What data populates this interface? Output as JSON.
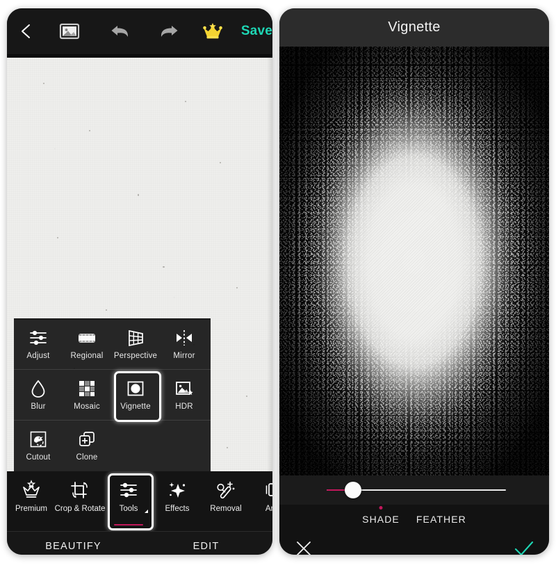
{
  "app": {
    "left_screen": {
      "topbar": {
        "back_icon": "chevron-left-icon",
        "photo_icon": "photo-gallery-icon",
        "undo_icon": "undo-arrow-icon",
        "redo_icon": "redo-arrow-icon",
        "premium_icon": "crown-star-icon",
        "save_label": "Save",
        "save_color": "#1ed6b4"
      },
      "tools_panel": {
        "selected": "Vignette",
        "items": [
          {
            "label": "Adjust",
            "icon": "sliders-icon"
          },
          {
            "label": "Regional",
            "icon": "regional-band-icon"
          },
          {
            "label": "Perspective",
            "icon": "perspective-grid-icon"
          },
          {
            "label": "Mirror",
            "icon": "mirror-icon"
          },
          {
            "label": "Blur",
            "icon": "water-drop-icon"
          },
          {
            "label": "Mosaic",
            "icon": "mosaic-grid-icon"
          },
          {
            "label": "Vignette",
            "icon": "vignette-frame-icon"
          },
          {
            "label": "HDR",
            "icon": "hdr-photo-icon"
          },
          {
            "label": "Cutout",
            "icon": "cutout-duck-icon"
          },
          {
            "label": "Clone",
            "icon": "clone-plus-icon"
          }
        ]
      },
      "bottom_strip": {
        "selected": "Tools",
        "accent_color": "#c2185b",
        "items": [
          {
            "label": "Premium",
            "icon": "crown-star-outline-icon"
          },
          {
            "label": "Crop & Rotate",
            "icon": "crop-rotate-icon"
          },
          {
            "label": "Tools",
            "icon": "sliders-icon"
          },
          {
            "label": "Effects",
            "icon": "magic-sparkle-icon"
          },
          {
            "label": "Removal",
            "icon": "magic-wand-icon"
          },
          {
            "label": "Anim",
            "icon": "animation-icon"
          }
        ]
      },
      "mode_tabs": {
        "active": "EDIT",
        "items": [
          {
            "label": "BEAUTIFY",
            "active": false
          },
          {
            "label": "EDIT",
            "active": true
          }
        ]
      }
    },
    "right_screen": {
      "header": {
        "title": "Vignette"
      },
      "preview": {
        "alt": "vignette-preview-image"
      },
      "slider": {
        "name": "vignette-intensity-slider",
        "value_percent": 15,
        "fill_color": "#c2185b",
        "track_color": "#e9e9e9"
      },
      "subtabs": {
        "active": "SHADE",
        "dot_color": "#c2185b",
        "items": [
          {
            "label": "SHADE",
            "active": true
          },
          {
            "label": "FEATHER",
            "active": false
          }
        ]
      },
      "actions": {
        "cancel_icon": "close-x-icon",
        "cancel_label": "Cancel",
        "apply_icon": "check-icon",
        "apply_label": "Apply",
        "apply_color": "#1ed6b4"
      }
    }
  }
}
